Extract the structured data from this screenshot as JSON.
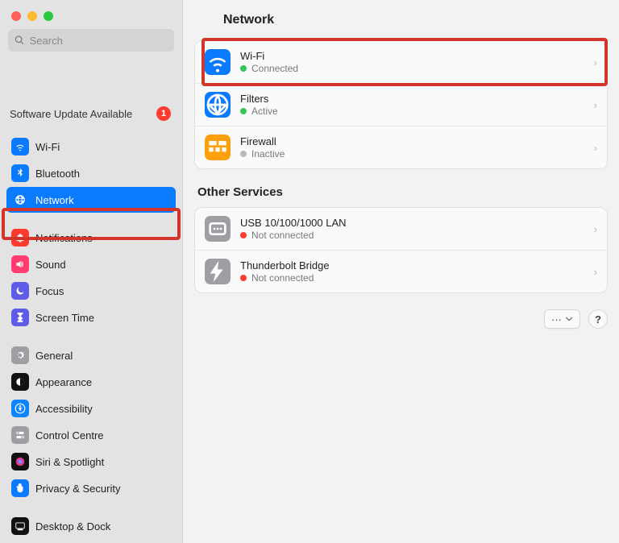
{
  "search": {
    "placeholder": "Search"
  },
  "softwareUpdate": {
    "label": "Software Update Available",
    "count": "1"
  },
  "sidebar": {
    "groups": [
      [
        {
          "id": "wifi",
          "label": "Wi-Fi",
          "iconBg": "#0a7aff",
          "icon": "wifi",
          "selected": false
        },
        {
          "id": "bluetooth",
          "label": "Bluetooth",
          "iconBg": "#0a7aff",
          "icon": "bluetooth",
          "selected": false
        },
        {
          "id": "network",
          "label": "Network",
          "iconBg": "#0a7aff",
          "icon": "globe",
          "selected": true
        }
      ],
      [
        {
          "id": "notifications",
          "label": "Notifications",
          "iconBg": "#ff3b30",
          "icon": "bell",
          "selected": false
        },
        {
          "id": "sound",
          "label": "Sound",
          "iconBg": "#ff3b6f",
          "icon": "sound",
          "selected": false
        },
        {
          "id": "focus",
          "label": "Focus",
          "iconBg": "#5e5ce6",
          "icon": "moon",
          "selected": false
        },
        {
          "id": "screentime",
          "label": "Screen Time",
          "iconBg": "#5e5ce6",
          "icon": "hourglass",
          "selected": false
        }
      ],
      [
        {
          "id": "general",
          "label": "General",
          "iconBg": "#9e9ea3",
          "icon": "gear",
          "selected": false
        },
        {
          "id": "appearance",
          "label": "Appearance",
          "iconBg": "#111",
          "icon": "appearance",
          "selected": false
        },
        {
          "id": "accessibility",
          "label": "Accessibility",
          "iconBg": "#0a84ff",
          "icon": "access",
          "selected": false
        },
        {
          "id": "controlcentre",
          "label": "Control Centre",
          "iconBg": "#9e9ea3",
          "icon": "toggles",
          "selected": false
        },
        {
          "id": "siri",
          "label": "Siri & Spotlight",
          "iconBg": "#111",
          "icon": "siri",
          "selected": false
        },
        {
          "id": "privacy",
          "label": "Privacy & Security",
          "iconBg": "#0a7aff",
          "icon": "hand",
          "selected": false
        }
      ],
      [
        {
          "id": "desktop",
          "label": "Desktop & Dock",
          "iconBg": "#111",
          "icon": "dock",
          "selected": false
        }
      ]
    ]
  },
  "main": {
    "title": "Network",
    "otherTitle": "Other Services",
    "primary": [
      {
        "id": "wifi",
        "name": "Wi-Fi",
        "status": "Connected",
        "dot": "#34c759",
        "iconBg": "#0a7aff",
        "icon": "wifi"
      },
      {
        "id": "filters",
        "name": "Filters",
        "status": "Active",
        "dot": "#34c759",
        "iconBg": "#0a7aff",
        "icon": "filters"
      },
      {
        "id": "firewall",
        "name": "Firewall",
        "status": "Inactive",
        "dot": "#b9b8b9",
        "iconBg": "#ff9f0a",
        "icon": "firewall"
      }
    ],
    "other": [
      {
        "id": "usb",
        "name": "USB 10/100/1000 LAN",
        "status": "Not connected",
        "dot": "#ff3b30",
        "iconBg": "#9e9ea3",
        "icon": "ethernet"
      },
      {
        "id": "thunderbolt",
        "name": "Thunderbolt Bridge",
        "status": "Not connected",
        "dot": "#ff3b30",
        "iconBg": "#9e9ea3",
        "icon": "bolt"
      }
    ]
  },
  "footer": {
    "more": "···",
    "help": "?"
  }
}
